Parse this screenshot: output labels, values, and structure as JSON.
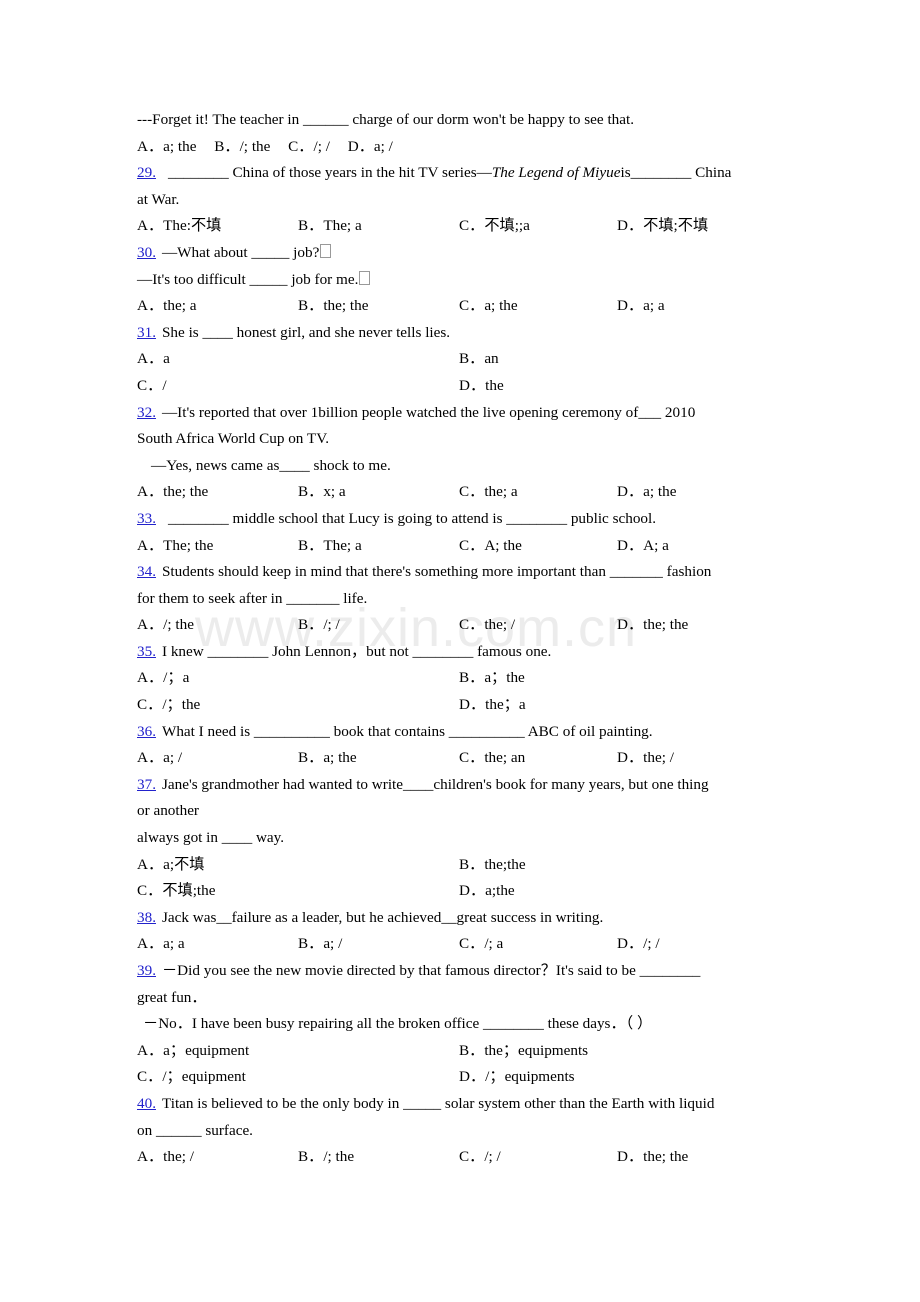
{
  "watermark": {
    "text": "www.zixin.com.cn"
  },
  "accent": {
    "question_number_color": "#2222cc"
  },
  "questions": [
    {
      "id": "q28-tail",
      "number": "",
      "stem_lines": [
        "---Forget it! The teacher in ______ charge of our dorm won't be happy to see that."
      ],
      "options_layout": "inline",
      "options": [
        "A．a; the",
        "B．/; the",
        "C．/; /",
        "D．a; /"
      ]
    },
    {
      "id": "q29",
      "number": "29.",
      "stem_pre": "________ China of those years in the hit TV series—",
      "stem_italic": "The Legend of Miyue",
      "stem_post": "is________ China",
      "stem_line2": "at War.",
      "options_layout": "four",
      "options": [
        "A．The:不填",
        "B．The; a",
        "C．不填;;a",
        "D．不填;不填"
      ]
    },
    {
      "id": "q30",
      "number": "30.",
      "stem_lines": [
        "—What about _____ job?",
        "—It's too difficult _____ job for me."
      ],
      "options_layout": "four",
      "options": [
        "A．the; a",
        "B．the; the",
        "C．a; the",
        "D．a; a"
      ]
    },
    {
      "id": "q31",
      "number": "31.",
      "stem_lines": [
        "She is ____ honest girl, and she never tells lies."
      ],
      "options_layout": "two",
      "options": [
        "A．a",
        "B．an",
        "C．/",
        "D．the"
      ]
    },
    {
      "id": "q32",
      "number": "32.",
      "stem_lines": [
        "—It's reported that over 1billion people watched the live opening ceremony of___ 2010",
        "South Africa World Cup on TV.",
        "—Yes, news came as____ shock to me."
      ],
      "options_layout": "four",
      "options": [
        "A．the; the",
        "B．x; a",
        "C．the; a",
        "D．a; the"
      ]
    },
    {
      "id": "q33",
      "number": "33.",
      "stem_lines": [
        "________ middle school that Lucy is going to attend is ________ public school."
      ],
      "options_layout": "four",
      "options": [
        "A．The; the",
        "B．The; a",
        "C．A; the",
        "D．A; a"
      ]
    },
    {
      "id": "q34",
      "number": "34.",
      "stem_lines": [
        "Students should keep in mind that there's something more important than _______ fashion",
        "for them to seek after in _______ life."
      ],
      "options_layout": "four",
      "options": [
        "A．/; the",
        "B．/; /",
        "C．the; /",
        "D．the; the"
      ]
    },
    {
      "id": "q35",
      "number": "35.",
      "stem_lines": [
        "I knew ________ John Lennon，but not ________ famous one."
      ],
      "options_layout": "two",
      "options": [
        "A．/；a",
        "B．a；the",
        "C．/；the",
        "D．the；a"
      ]
    },
    {
      "id": "q36",
      "number": "36.",
      "stem_lines": [
        "What I need is __________ book that contains __________ ABC of oil painting."
      ],
      "options_layout": "four",
      "options": [
        "A．a; /",
        "B．a; the",
        "C．the; an",
        "D．the; /"
      ]
    },
    {
      "id": "q37",
      "number": "37.",
      "stem_lines": [
        "Jane's grandmother had wanted to write____children's book for many years, but one thing",
        "or another",
        "always got in ____ way."
      ],
      "options_layout": "two",
      "options": [
        "A．a;不填",
        "B．the;the",
        "C．不填;the",
        "D．a;the"
      ]
    },
    {
      "id": "q38",
      "number": "38.",
      "stem_lines": [
        "Jack was__failure as a leader, but he achieved__great success in writing."
      ],
      "options_layout": "four",
      "options": [
        "A．a; a",
        "B．a; /",
        "C．/; a",
        "D．/; /"
      ]
    },
    {
      "id": "q39",
      "number": "39.",
      "stem_lines": [
        "－Did you see the new movie directed by that famous director？It's said to be ________",
        "great fun．",
        "－No．I have been busy repairing all the broken office ________ these days．（    ）"
      ],
      "options_layout": "two",
      "options": [
        "A．a；equipment",
        "B．the；equipments",
        "C．/；equipment",
        "D．/；equipments"
      ]
    },
    {
      "id": "q40",
      "number": "40.",
      "stem_lines": [
        "Titan is believed to be the only body in _____ solar system other than the Earth with liquid",
        "on ______ surface."
      ],
      "options_layout": "four",
      "options": [
        "A．the; /",
        "B．/; the",
        "C．/; /",
        "D．the; the"
      ]
    }
  ]
}
